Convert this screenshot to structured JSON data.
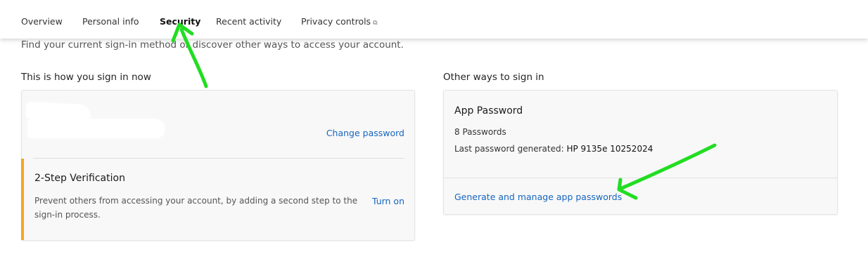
{
  "nav": {
    "tabs": [
      {
        "label": "Overview"
      },
      {
        "label": "Personal info"
      },
      {
        "label": "Security"
      },
      {
        "label": "Recent activity"
      },
      {
        "label": "Privacy controls",
        "icon": "external-link-icon",
        "glyph": "⧉"
      }
    ],
    "active_tab": "Security"
  },
  "intro": "Find your current sign-in method or discover other ways to access your account.",
  "current_signin": {
    "title": "This is how you sign in now",
    "change_password": "Change password",
    "two_step": {
      "title": "2-Step Verification",
      "description": "Prevent others from accessing your account, by adding a second step to the sign-in process.",
      "action": "Turn on"
    }
  },
  "other_signin": {
    "title": "Other ways to sign in",
    "app_password": {
      "title": "App Password",
      "count": "8 Passwords",
      "last_generated_label": "Last password generated:",
      "last_generated_value": "HP 9135e 10252024",
      "manage_link": "Generate and manage app passwords"
    }
  },
  "colors": {
    "accent": "#f5a623",
    "link": "#1565c0",
    "annotation_arrow": "#22dd22"
  }
}
